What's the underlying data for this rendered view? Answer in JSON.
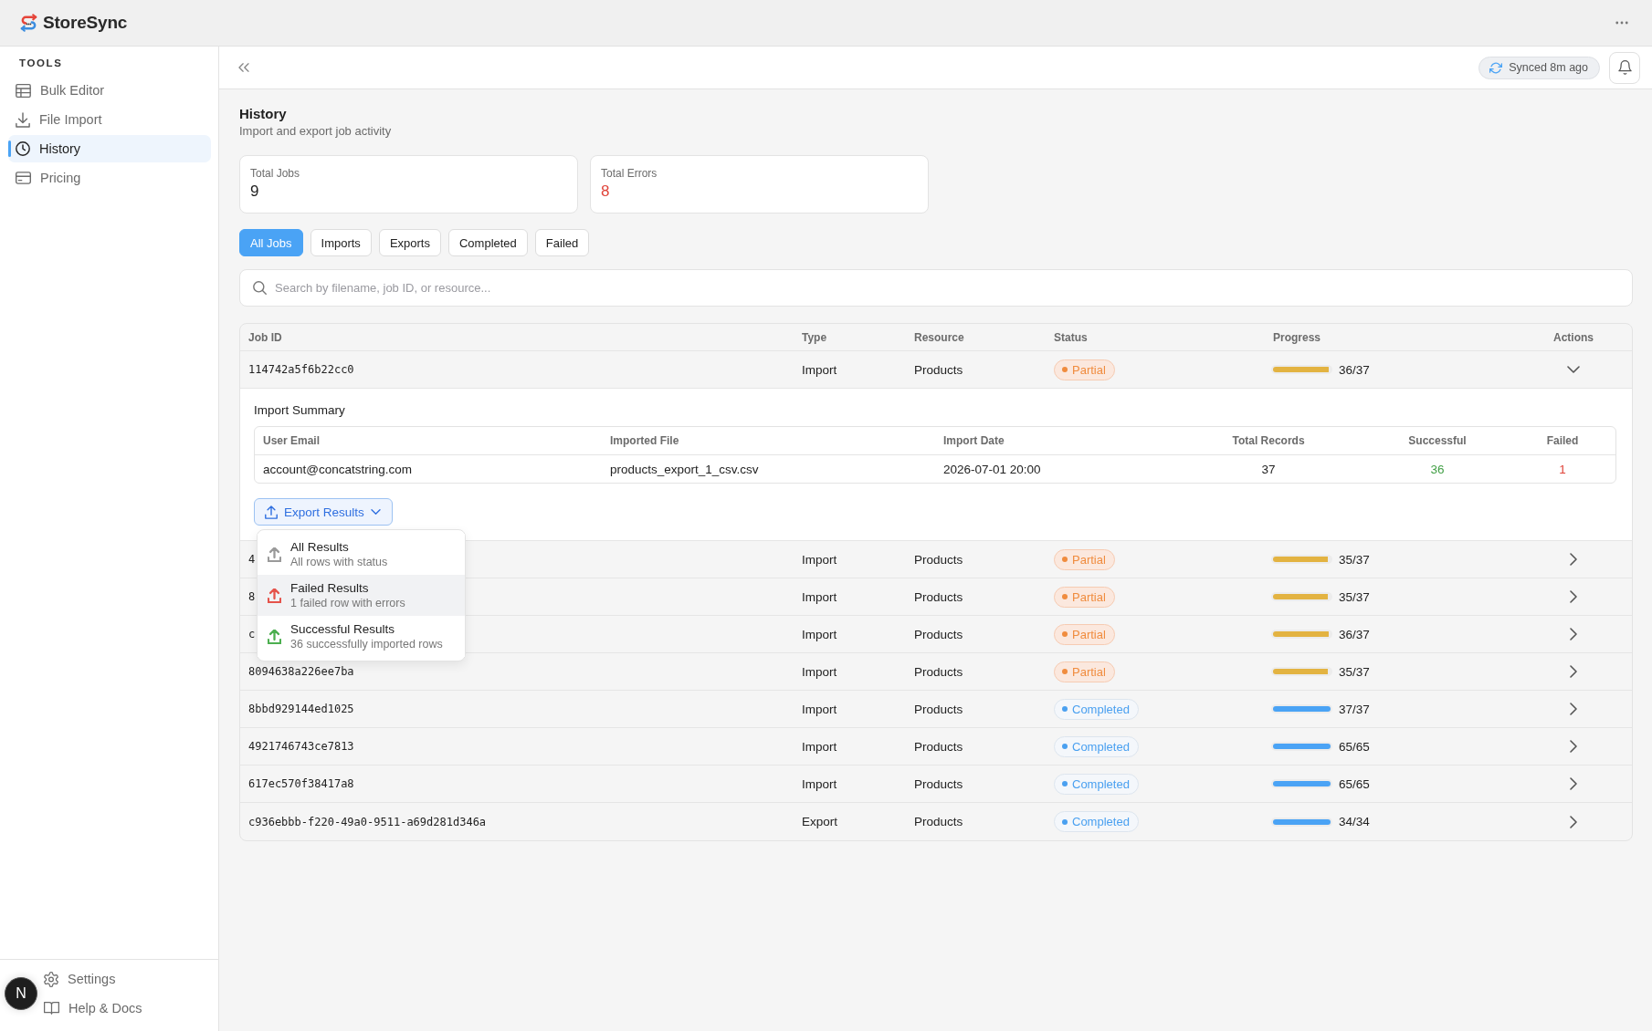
{
  "app": {
    "name": "StoreSync"
  },
  "sidebar": {
    "section_label": "TOOLS",
    "items": [
      {
        "label": "Bulk Editor",
        "selected": false
      },
      {
        "label": "File Import",
        "selected": false
      },
      {
        "label": "History",
        "selected": true
      },
      {
        "label": "Pricing",
        "selected": false
      }
    ],
    "footer_items": [
      {
        "label": "Settings"
      },
      {
        "label": "Help & Docs"
      }
    ]
  },
  "dev_badge": {
    "label": "N"
  },
  "toolbar": {
    "sync_status": "Synced 8m ago"
  },
  "page": {
    "title": "History",
    "subtitle": "Import and export job activity"
  },
  "stats": [
    {
      "label": "Total Jobs",
      "value": "9",
      "kind": "count"
    },
    {
      "label": "Total Errors",
      "value": "8",
      "kind": "error"
    }
  ],
  "filters": [
    {
      "label": "All Jobs",
      "selected": true
    },
    {
      "label": "Imports",
      "selected": false
    },
    {
      "label": "Exports",
      "selected": false
    },
    {
      "label": "Completed",
      "selected": false
    },
    {
      "label": "Failed",
      "selected": false
    }
  ],
  "search": {
    "placeholder": "Search by filename, job ID, or resource..."
  },
  "table": {
    "columns": [
      "Job ID",
      "Type",
      "Resource",
      "Status",
      "Progress",
      "Actions"
    ],
    "rows": [
      {
        "job_id": "114742a5f6b22cc0",
        "type": "Import",
        "resource": "Products",
        "status": {
          "kind": "partial",
          "label": "Partial"
        },
        "progress": {
          "level": 0.973,
          "reading": "36/37"
        },
        "expanded": true,
        "details": {
          "title": "Import Summary",
          "columns": [
            {
              "header": "User Email",
              "value": "account@concatstring.com",
              "kind": "text"
            },
            {
              "header": "Imported File",
              "value": "products_export_1_csv.csv",
              "kind": "text"
            },
            {
              "header": "Import Date",
              "value": "2026-07-01 20:00",
              "kind": "text"
            },
            {
              "header": "Total Records",
              "value": "37",
              "kind": "number"
            },
            {
              "header": "Successful",
              "value": "36",
              "kind": "success"
            },
            {
              "header": "Failed",
              "value": "1",
              "kind": "error"
            }
          ],
          "export_button": {
            "label": "Export Results"
          },
          "export_menu": {
            "open": true,
            "items": [
              {
                "title": "All Results",
                "description": "All rows with status",
                "color": "#9a9a9a",
                "highlighted": false
              },
              {
                "title": "Failed Results",
                "description": "1 failed row with errors",
                "color": "#e5534b",
                "highlighted": true
              },
              {
                "title": "Successful Results",
                "description": "36 successfully imported rows",
                "color": "#4caf50",
                "highlighted": false
              }
            ]
          }
        }
      },
      {
        "job_id": "4",
        "type": "Import",
        "resource": "Products",
        "status": {
          "kind": "partial",
          "label": "Partial"
        },
        "progress": {
          "level": 0.946,
          "reading": "35/37"
        },
        "expanded": false
      },
      {
        "job_id": "8",
        "type": "Import",
        "resource": "Products",
        "status": {
          "kind": "partial",
          "label": "Partial"
        },
        "progress": {
          "level": 0.946,
          "reading": "35/37"
        },
        "expanded": false
      },
      {
        "job_id": "c",
        "type": "Import",
        "resource": "Products",
        "status": {
          "kind": "partial",
          "label": "Partial"
        },
        "progress": {
          "level": 0.973,
          "reading": "36/37"
        },
        "expanded": false
      },
      {
        "job_id": "8094638a226ee7ba",
        "type": "Import",
        "resource": "Products",
        "status": {
          "kind": "partial",
          "label": "Partial"
        },
        "progress": {
          "level": 0.946,
          "reading": "35/37"
        },
        "expanded": false
      },
      {
        "job_id": "8bbd929144ed1025",
        "type": "Import",
        "resource": "Products",
        "status": {
          "kind": "completed",
          "label": "Completed"
        },
        "progress": {
          "level": 1.0,
          "reading": "37/37"
        },
        "expanded": false
      },
      {
        "job_id": "4921746743ce7813",
        "type": "Import",
        "resource": "Products",
        "status": {
          "kind": "completed",
          "label": "Completed"
        },
        "progress": {
          "level": 1.0,
          "reading": "65/65"
        },
        "expanded": false
      },
      {
        "job_id": "617ec570f38417a8",
        "type": "Import",
        "resource": "Products",
        "status": {
          "kind": "completed",
          "label": "Completed"
        },
        "progress": {
          "level": 1.0,
          "reading": "65/65"
        },
        "expanded": false
      },
      {
        "job_id": "c936ebbb-f220-49a0-9511-a69d281d346a",
        "type": "Export",
        "resource": "Products",
        "status": {
          "kind": "completed",
          "label": "Completed"
        },
        "progress": {
          "level": 1.0,
          "reading": "34/34"
        },
        "expanded": false
      }
    ]
  }
}
